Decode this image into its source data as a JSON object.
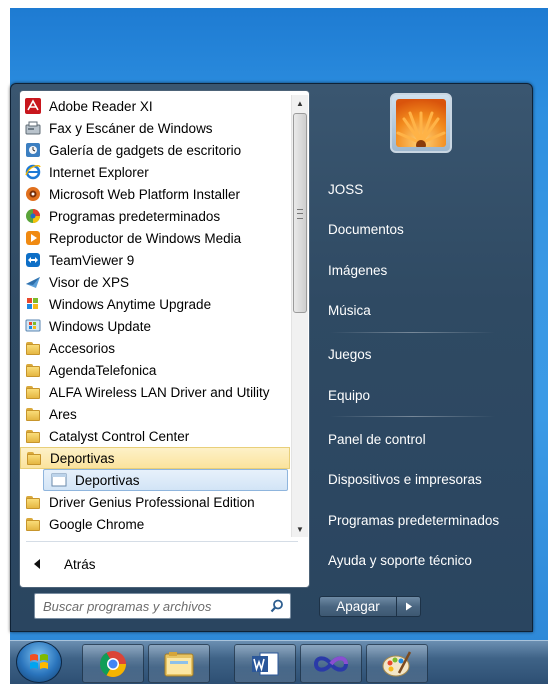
{
  "programs": [
    {
      "label": "Adobe Reader XI",
      "icon": "adobe-reader-icon"
    },
    {
      "label": "Fax y Escáner de Windows",
      "icon": "fax-scanner-icon"
    },
    {
      "label": "Galería de gadgets de escritorio",
      "icon": "gadgets-icon"
    },
    {
      "label": "Internet Explorer",
      "icon": "internet-explorer-icon"
    },
    {
      "label": "Microsoft Web Platform Installer",
      "icon": "web-platform-icon"
    },
    {
      "label": "Programas predeterminados",
      "icon": "default-programs-icon"
    },
    {
      "label": "Reproductor de Windows Media",
      "icon": "media-player-icon"
    },
    {
      "label": "TeamViewer 9",
      "icon": "teamviewer-icon"
    },
    {
      "label": "Visor de XPS",
      "icon": "xps-viewer-icon"
    },
    {
      "label": "Windows Anytime Upgrade",
      "icon": "windows-flag-icon"
    },
    {
      "label": "Windows Update",
      "icon": "windows-update-icon"
    },
    {
      "label": "Accesorios",
      "icon": "folder-icon"
    },
    {
      "label": "AgendaTelefonica",
      "icon": "folder-icon"
    },
    {
      "label": "ALFA Wireless LAN Driver and Utility",
      "icon": "folder-icon"
    },
    {
      "label": "Ares",
      "icon": "folder-icon"
    },
    {
      "label": "Catalyst Control Center",
      "icon": "folder-icon"
    },
    {
      "label": "Deportivas",
      "icon": "folder-icon"
    },
    {
      "label": "Deportivas",
      "icon": "window-icon"
    },
    {
      "label": "Driver Genius Professional Edition",
      "icon": "folder-icon"
    },
    {
      "label": "Google Chrome",
      "icon": "folder-icon"
    }
  ],
  "back_label": "Atrás",
  "search": {
    "placeholder": "Buscar programas y archivos"
  },
  "right_menu": {
    "user": "JOSS",
    "documents": "Documentos",
    "pictures": "Imágenes",
    "music": "Música",
    "games": "Juegos",
    "computer": "Equipo",
    "control_panel": "Panel de control",
    "devices": "Dispositivos e impresoras",
    "default_programs": "Programas predeterminados",
    "help": "Ayuda y soporte técnico"
  },
  "shutdown_label": "Apagar",
  "taskbar": [
    "start-orb",
    "chrome-icon",
    "explorer-icon",
    "word-icon",
    "infinity-app-icon",
    "paint-icon"
  ],
  "colors": {
    "selected_folder": "#fbe39d",
    "selected_sub": "#d2e4f6",
    "right_pane": "#2f4a63"
  }
}
